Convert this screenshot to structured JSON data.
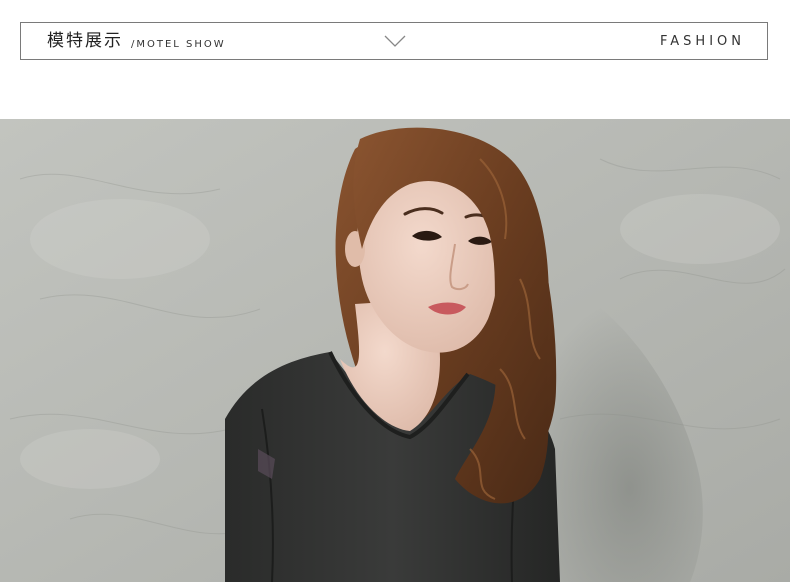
{
  "header": {
    "title_cn": "模特展示",
    "title_en": "/MOTEL SHOW",
    "right_label": "FASHION",
    "divider_icon": "chevron-down-icon"
  },
  "photo": {
    "subject": "model-photo",
    "colors": {
      "wall": "#b9bbb6",
      "wall_dark": "#8e918c",
      "hair": "#6a3f22",
      "skin": "#e9cbbd",
      "shirt": "#2c2d2c"
    }
  }
}
